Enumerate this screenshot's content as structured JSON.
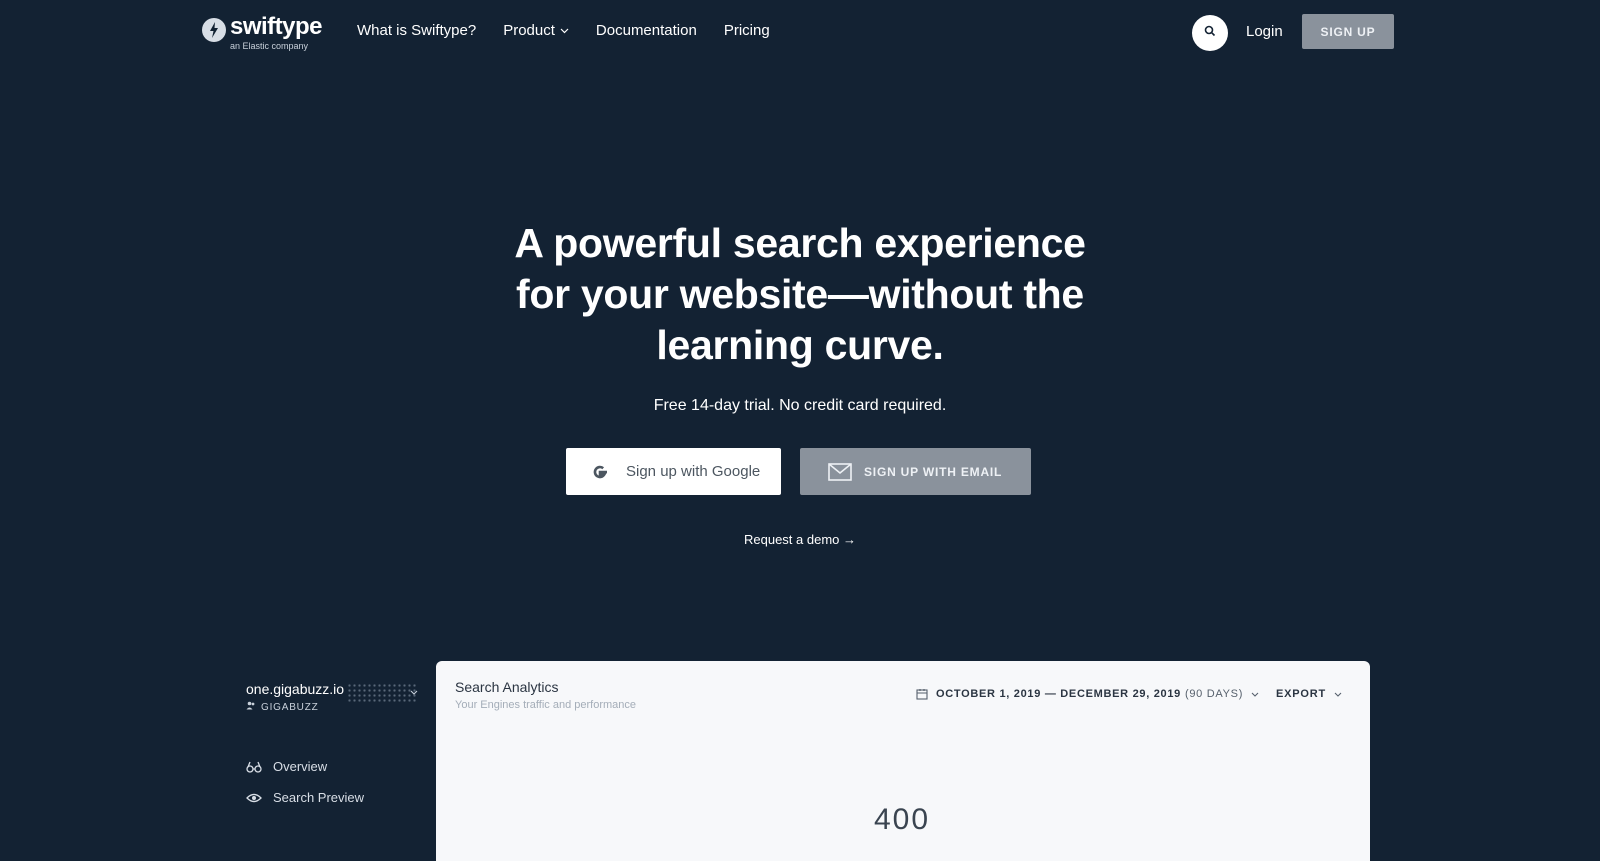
{
  "nav": {
    "logo_word": "swiftype",
    "logo_sub": "an Elastic company",
    "links": [
      {
        "label": "What is Swiftype?"
      },
      {
        "label": "Product",
        "has_dropdown": true
      },
      {
        "label": "Documentation"
      },
      {
        "label": "Pricing"
      }
    ],
    "search_icon": "search-icon",
    "login_label": "Login",
    "signup_label": "SIGN UP"
  },
  "hero": {
    "title_lines": [
      "A powerful search experience",
      "for your website—without the",
      "learning curve."
    ],
    "subtitle": "Free 14-day trial. No credit card required.",
    "google_button_label": "Sign up with Google",
    "email_button_label": "SIGN UP WITH EMAIL",
    "demo_link_label": "Request a demo →"
  },
  "dashboard": {
    "site_name": "one.gigabuzz.io",
    "org_name": "GIGABUZZ",
    "sidebar_items": [
      {
        "label": "Overview",
        "icon": "binoculars-icon"
      },
      {
        "label": "Search Preview",
        "icon": "eye-icon"
      }
    ],
    "panel_title": "Search Analytics",
    "panel_subtitle": "Your Engines traffic and performance",
    "date_range": "OCTOBER 1, 2019 — DECEMBER 29, 2019",
    "date_days": "(90 DAYS)",
    "export_label": "EXPORT",
    "metric_peek": "400"
  },
  "colors": {
    "background": "#132233",
    "button_gray": "#8a929c",
    "panel_bg": "#f7f8fa"
  }
}
